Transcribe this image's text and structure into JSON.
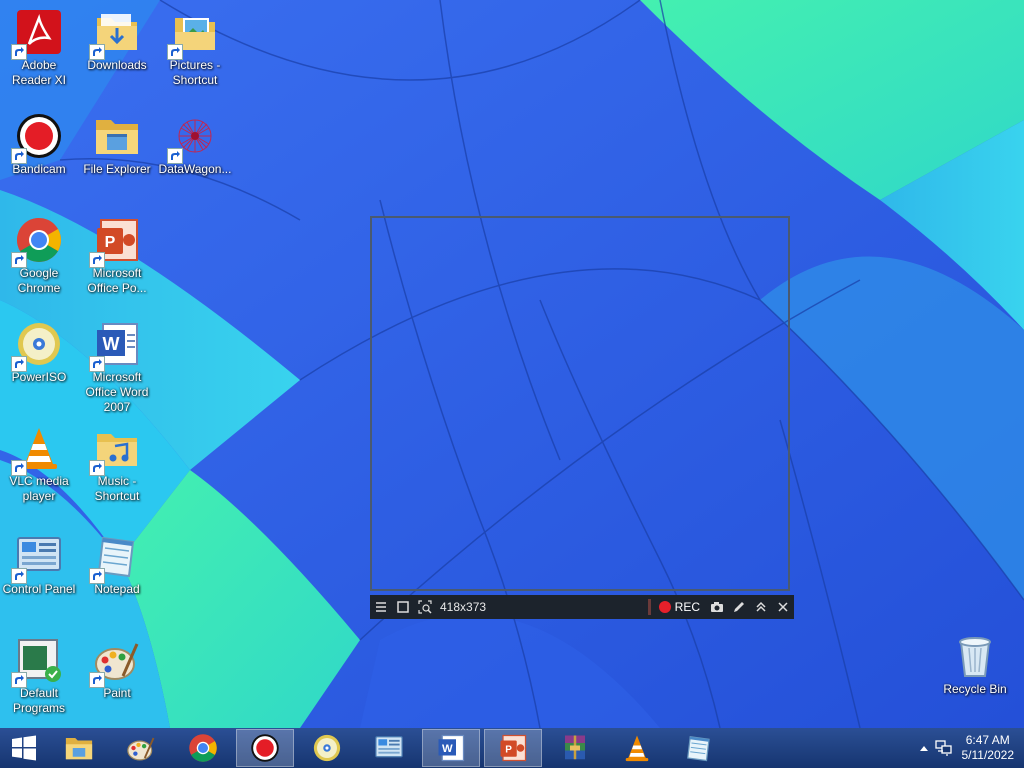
{
  "desktop": {
    "icons": [
      {
        "label": "Adobe Reader XI",
        "icon": "adobe-reader-icon"
      },
      {
        "label": "Downloads",
        "icon": "downloads-folder-icon"
      },
      {
        "label": "Pictures - Shortcut",
        "icon": "pictures-folder-icon"
      },
      {
        "label": "Bandicam",
        "icon": "bandicam-icon"
      },
      {
        "label": "File Explorer",
        "icon": "file-explorer-icon"
      },
      {
        "label": "DataWagon...",
        "icon": "datawagon-icon"
      },
      {
        "label": "Google Chrome",
        "icon": "chrome-icon"
      },
      {
        "label": "Microsoft Office Po...",
        "icon": "powerpoint-icon"
      },
      {
        "label": "PowerISO",
        "icon": "poweriso-icon"
      },
      {
        "label": "Microsoft Office Word 2007",
        "icon": "word-icon"
      },
      {
        "label": "VLC media player",
        "icon": "vlc-icon"
      },
      {
        "label": "Music - Shortcut",
        "icon": "music-folder-icon"
      },
      {
        "label": "Control Panel",
        "icon": "control-panel-icon"
      },
      {
        "label": "Notepad",
        "icon": "notepad-icon"
      },
      {
        "label": "Default Programs",
        "icon": "default-programs-icon"
      },
      {
        "label": "Paint",
        "icon": "paint-icon"
      },
      {
        "label": "Recycle Bin",
        "icon": "recycle-bin-icon"
      }
    ]
  },
  "capture": {
    "size_text": "418x373",
    "rec_label": "REC"
  },
  "taskbar": {
    "items": [
      {
        "icon": "file-explorer-icon"
      },
      {
        "icon": "paint-icon"
      },
      {
        "icon": "chrome-icon"
      },
      {
        "icon": "bandicam-icon"
      },
      {
        "icon": "poweriso-icon"
      },
      {
        "icon": "control-panel-icon"
      },
      {
        "icon": "word-icon"
      },
      {
        "icon": "powerpoint-icon"
      },
      {
        "icon": "winrar-icon"
      },
      {
        "icon": "vlc-icon"
      },
      {
        "icon": "notepad-icon"
      }
    ],
    "active_items": [
      "bandicam-icon",
      "word-icon",
      "powerpoint-icon"
    ],
    "clock": {
      "time": "6:47 AM",
      "date": "5/11/2022"
    }
  },
  "colors": {
    "taskbar": "#1f4384",
    "wallpaper_blue": "#2e5fe0",
    "wallpaper_cyan": "#2fc6e8",
    "wallpaper_green": "#3fe8a8",
    "rec_dot": "#e8202a"
  }
}
